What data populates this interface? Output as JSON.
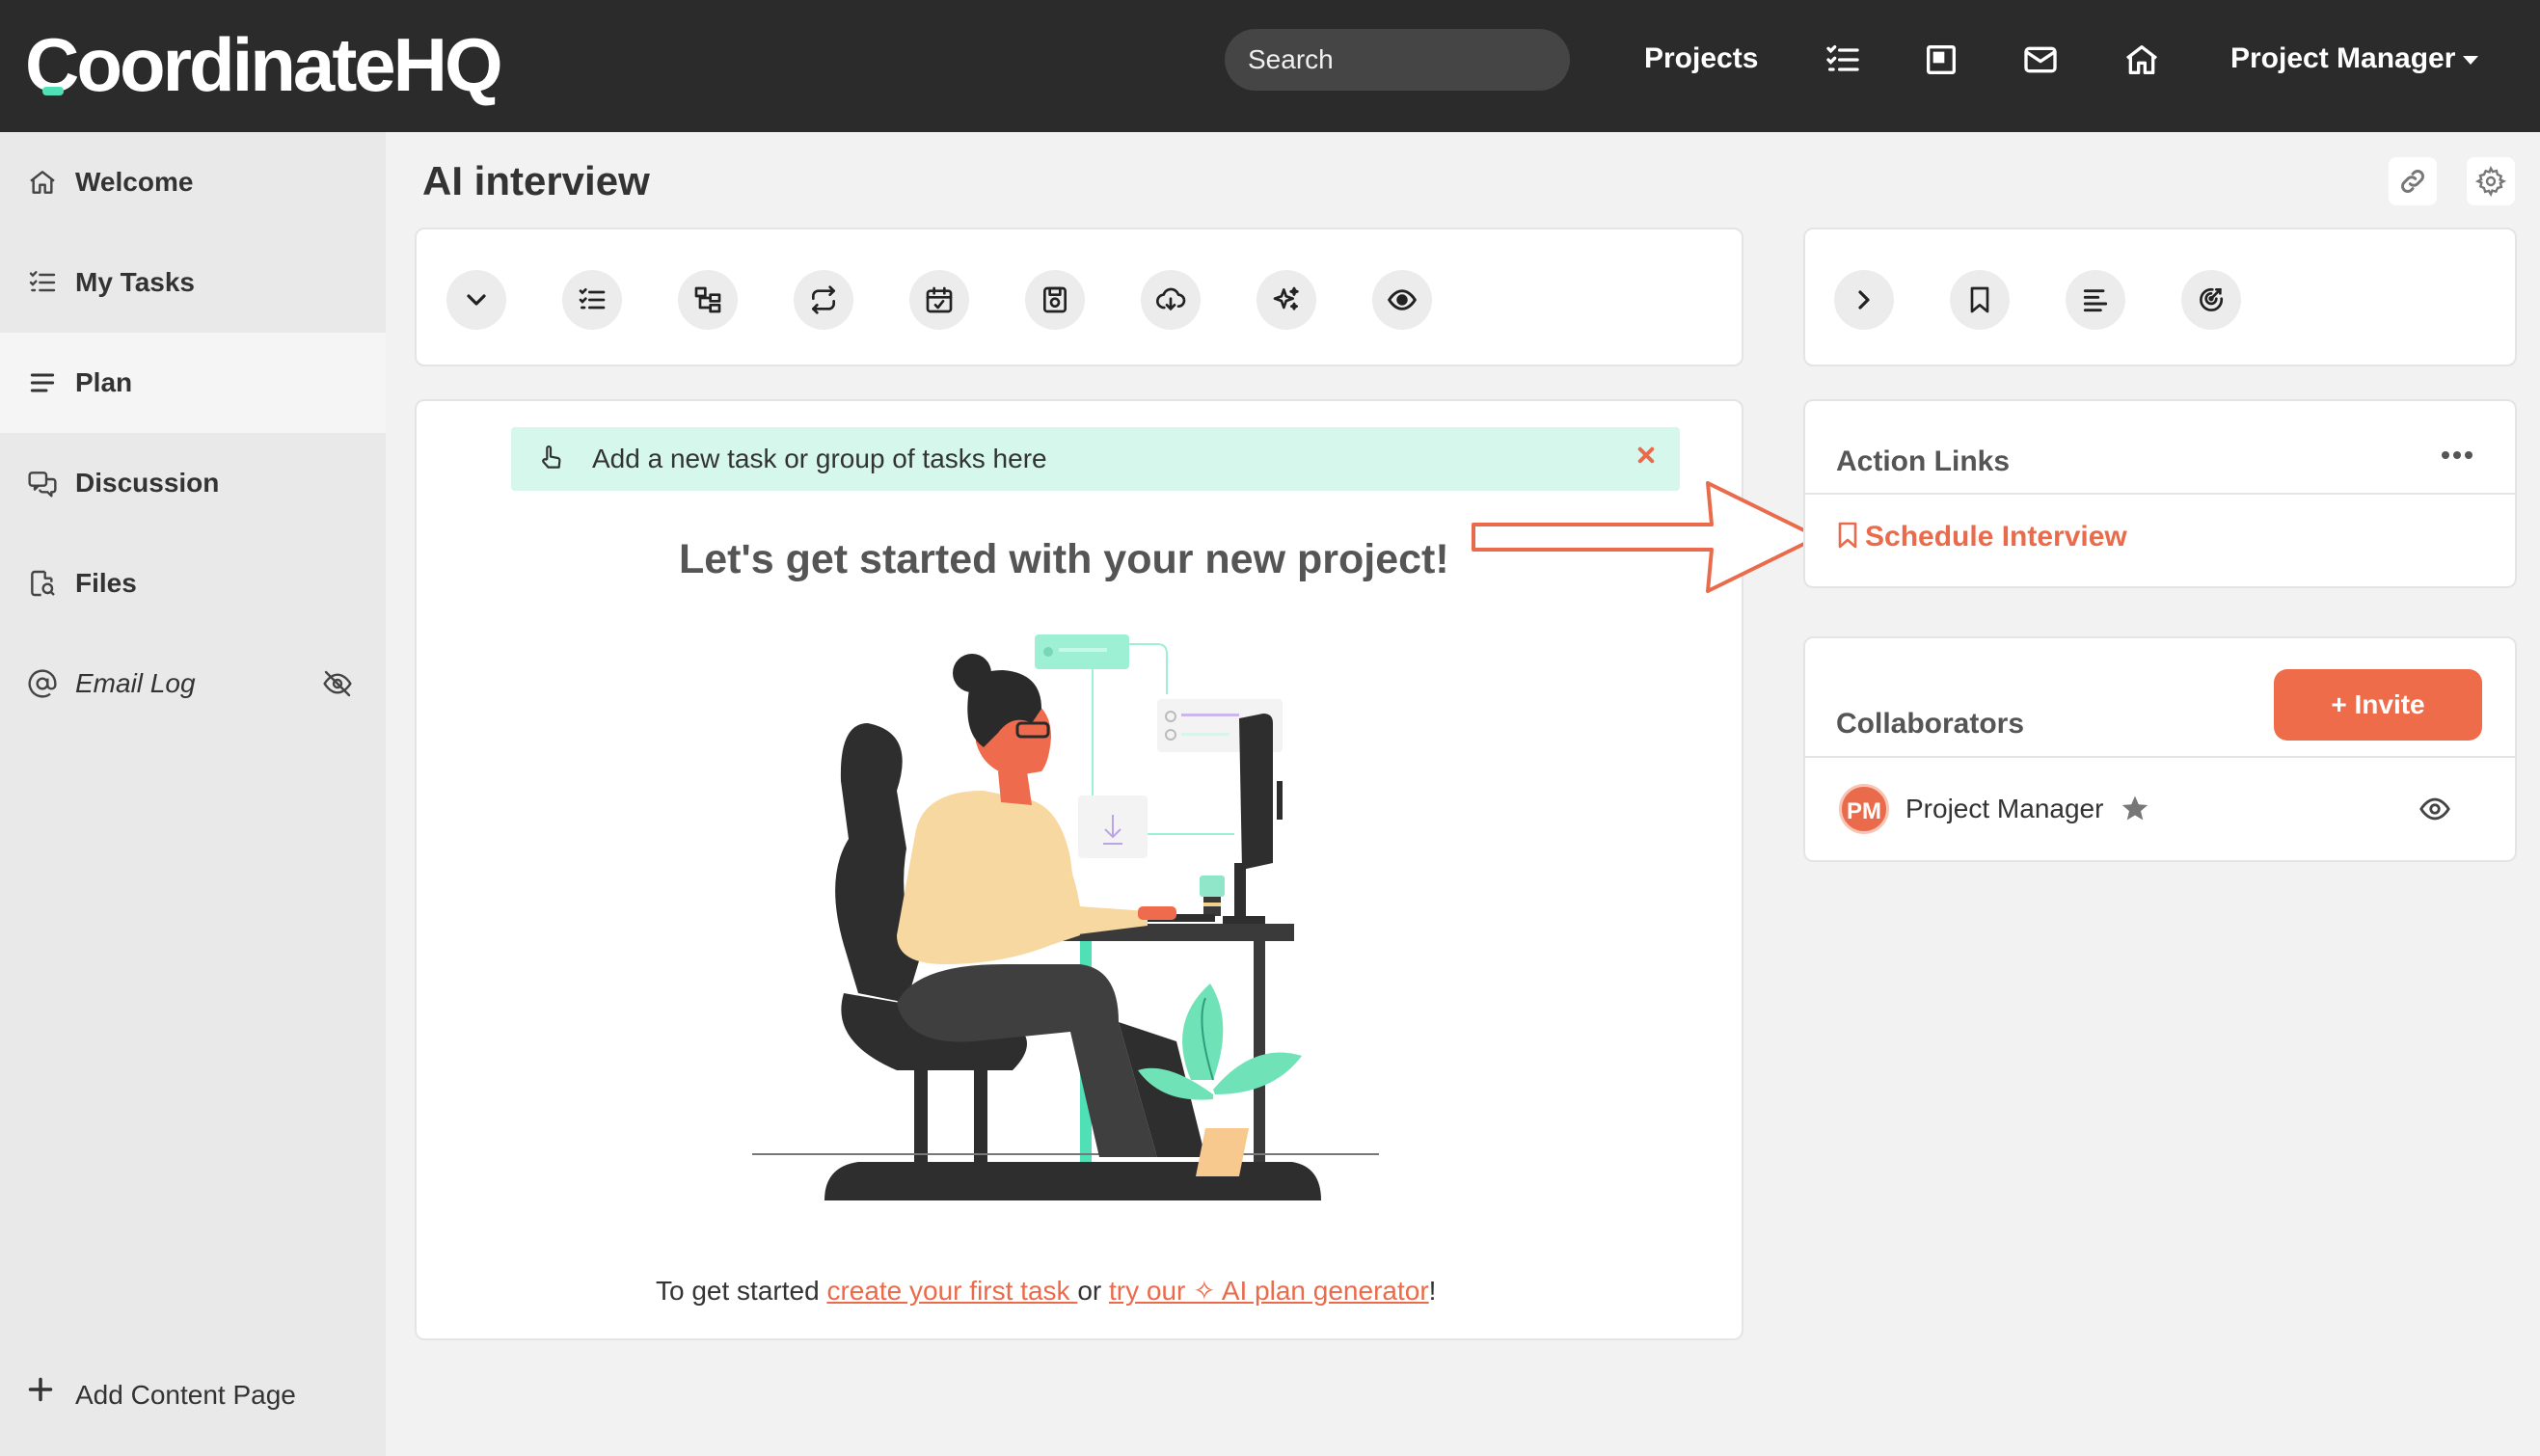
{
  "header": {
    "logo": "CoordinateHQ",
    "search_placeholder": "Search",
    "projects_label": "Projects",
    "user_label": "Project Manager"
  },
  "sidebar": {
    "items": [
      {
        "label": "Welcome",
        "icon": "home-icon"
      },
      {
        "label": "My Tasks",
        "icon": "task-list-icon"
      },
      {
        "label": "Plan",
        "icon": "menu-lines-icon"
      },
      {
        "label": "Discussion",
        "icon": "chat-icon"
      },
      {
        "label": "Files",
        "icon": "file-search-icon"
      },
      {
        "label": "Email Log",
        "icon": "at-icon"
      }
    ],
    "active_item": "Plan",
    "add_page_label": "Add Content Page"
  },
  "page": {
    "title": "AI interview"
  },
  "plan": {
    "toolbar_icons": [
      "chevron-down-icon",
      "task-list-icon",
      "hierarchy-icon",
      "repeat-icon",
      "calendar-check-icon",
      "save-icon",
      "cloud-download-icon",
      "sparkle-icon",
      "eye-icon"
    ],
    "banner_text": "Add a new task or group of tasks here",
    "empty_title": "Let's get started with your new project!",
    "footer_prefix": "To get started ",
    "footer_link1": "create your first task ",
    "footer_mid": "or ",
    "footer_link2": "try our ✧ AI plan generator",
    "footer_suffix": "!"
  },
  "right_panel": {
    "toolbar_icons": [
      "chevron-right-icon",
      "bookmark-icon",
      "align-left-icon",
      "target-icon"
    ],
    "action_links_title": "Action Links",
    "action_link_label": "Schedule Interview",
    "collaborators_title": "Collaborators",
    "invite_label": "+ Invite",
    "collaborators": [
      {
        "initials": "PM",
        "name": "Project Manager"
      }
    ]
  },
  "colors": {
    "accent": "#ea6b4b",
    "topbar": "#2b2b2b",
    "banner": "#d5f7ec",
    "mint": "#4fe0b6"
  }
}
